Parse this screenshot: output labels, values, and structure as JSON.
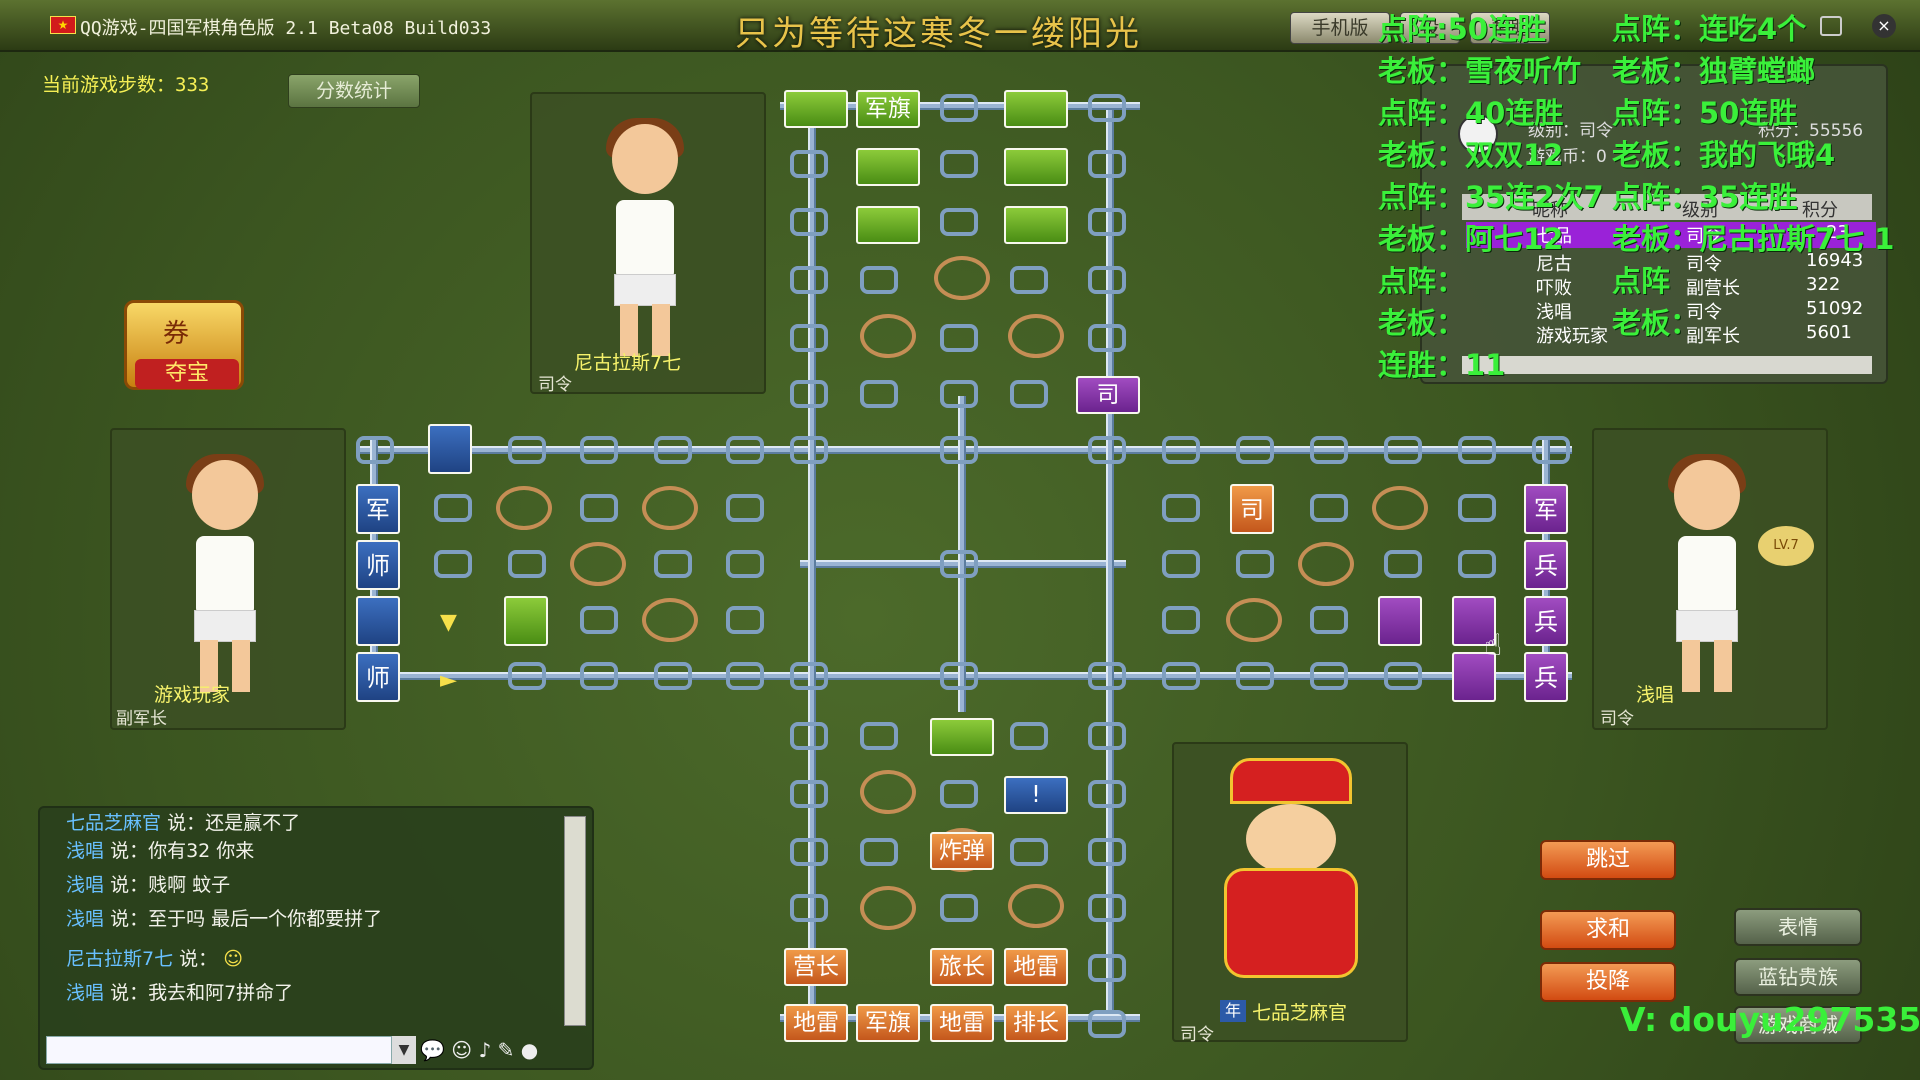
{
  "titlebar": {
    "title": "QQ游戏-四国军棋角色版 2.1 Beta08 Build033",
    "banner": "只为等待这寒冬一缕阳光",
    "mobile_btn": "手机版",
    "settings_btn": "设",
    "help_btn": "帮助"
  },
  "status": {
    "step_label": "当前游戏步数：333",
    "score_btn": "分数统计",
    "treasure": "夺宝",
    "treasure_ticket": "券"
  },
  "players": {
    "top": {
      "name": "尼古拉斯7七",
      "rank": "司令"
    },
    "left": {
      "name": "游戏玩家",
      "rank": "副军长"
    },
    "right": {
      "name": "浅唱",
      "rank": "司令",
      "level": "LV.7"
    },
    "bottom": {
      "name": "七品芝麻官",
      "rank": "司令",
      "badge": "年"
    }
  },
  "pieces": {
    "jq": "军旗",
    "jun": "军",
    "shi": "师",
    "si": "司",
    "bing": "兵",
    "zha": "炸弹",
    "yingzhang": "营长",
    "lvzhang": "旅长",
    "dilei": "地雷",
    "paizhang": "排长",
    "ex": "!"
  },
  "chat": {
    "lines": [
      {
        "who": "七品芝麻官",
        "msg": "说：还是赢不了"
      },
      {
        "who": "浅唱",
        "msg": "说：你有32 你来"
      },
      {
        "who": "浅唱",
        "msg": "说：贱啊    蚊子"
      },
      {
        "who": "浅唱",
        "msg": "说：至于吗  最后一个你都要拼了"
      },
      {
        "who": "尼古拉斯7七",
        "msg": "说："
      },
      {
        "who": "浅唱",
        "msg": "说：我去和阿7拼命了"
      }
    ]
  },
  "actions": {
    "skip": "跳过",
    "peace": "求和",
    "surrender": "投降",
    "emote": "表情",
    "diamond": "蓝钻贵族",
    "extra": "游戏商城"
  },
  "overlay": {
    "lines": [
      "点阵:50连胜",
      "点阵：连吃4个",
      "老板：雪夜听竹",
      "老板：独臂螳螂",
      "点阵：40连胜",
      "点阵：50连胜",
      "老板：双双12",
      "老板：我的飞哦4",
      "点阵：35连2次7",
      "点阵：35连胜",
      "老板：阿七12",
      "老板：尼古拉斯7七 1",
      "点阵：",
      "点阵",
      "老板：",
      "老板：",
      "连胜：11"
    ],
    "watermark": "V:  douyu297535"
  },
  "plist": {
    "header": {
      "nick": "昵称",
      "level": "级别",
      "score": "积分"
    },
    "me_level": "级别：司令",
    "me_score": "积分：55556",
    "me_coin": "游戏币：0",
    "rows": [
      {
        "nick": "七品",
        "level": "司令",
        "score": "23"
      },
      {
        "nick": "尼古",
        "level": "司令",
        "score": "16943"
      },
      {
        "nick": "吓败",
        "level": "副营长",
        "score": "322"
      },
      {
        "nick": "浅唱",
        "level": "司令",
        "score": "51092"
      },
      {
        "nick": "游戏玩家",
        "level": "副军长",
        "score": "5601"
      }
    ]
  },
  "colors": {
    "accent_green": "#3af03a",
    "orange": "#e07a2c",
    "purple": "#8a3aaf",
    "blue": "#2c5aa8",
    "board_line": "#9ab4d3"
  }
}
